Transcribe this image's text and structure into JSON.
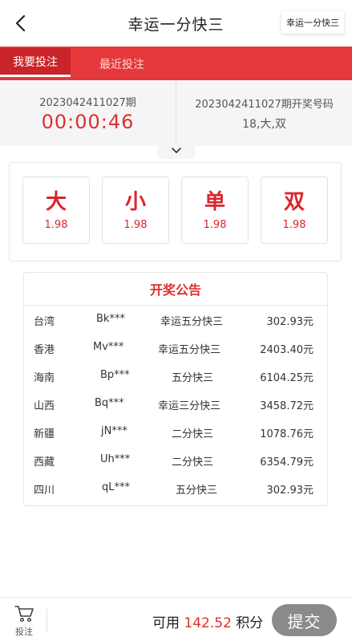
{
  "header": {
    "title": "幸运一分快三",
    "game_switch": "幸运一分快三"
  },
  "tabs": [
    {
      "label": "我要投注",
      "active": true
    },
    {
      "label": "最近投注",
      "active": false
    }
  ],
  "current_period": {
    "issue": "2023042411027期",
    "countdown": "00:00:46"
  },
  "last_draw": {
    "title": "2023042411027期开奖号码",
    "result": "18,大,双"
  },
  "bet_options": [
    {
      "label": "大",
      "odds": "1.98"
    },
    {
      "label": "小",
      "odds": "1.98"
    },
    {
      "label": "单",
      "odds": "1.98"
    },
    {
      "label": "双",
      "odds": "1.98"
    }
  ],
  "announcement": {
    "title": "开奖公告",
    "rows": [
      {
        "region": "台湾",
        "user": "Bk***",
        "game": "幸运五分快三",
        "amount": "302.93元"
      },
      {
        "region": "香港",
        "user": "Mv***",
        "game": "幸运五分快三",
        "amount": "2403.40元"
      },
      {
        "region": "海南",
        "user": "Bp***",
        "game": "五分快三",
        "amount": "6104.25元"
      },
      {
        "region": "山西",
        "user": "Bq***",
        "game": "幸运三分快三",
        "amount": "3458.72元"
      },
      {
        "region": "新疆",
        "user": "jN***",
        "game": "二分快三",
        "amount": "1078.76元"
      },
      {
        "region": "西藏",
        "user": "Uh***",
        "game": "二分快三",
        "amount": "6354.79元"
      },
      {
        "region": "四川",
        "user": "qL***",
        "game": "五分快三",
        "amount": "302.93元"
      }
    ]
  },
  "bottom": {
    "cart_label": "投注",
    "balance_prefix": "可用",
    "balance_amount": "142.52",
    "balance_unit": "积分",
    "submit_label": "提交"
  },
  "colors": {
    "accent_red": "#e5383b",
    "text_red": "#d9262c",
    "submit_gray": "#8a8a8a"
  },
  "icons": {
    "back": "chevron-left-icon",
    "expand": "chevron-down-icon",
    "cart": "cart-icon"
  }
}
